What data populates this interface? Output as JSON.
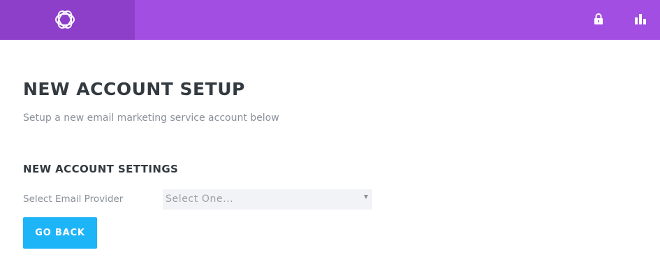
{
  "colors": {
    "topbar": "#a34ee2",
    "logo_block": "#8e3fca",
    "accent_button": "#1eb4f8",
    "heading": "#333a40",
    "muted_text": "#8a9099",
    "select_bg": "#f2f3f6"
  },
  "header": {
    "logo_icon": "bloom-logo-icon",
    "icons": [
      "lock-icon",
      "stats-icon"
    ]
  },
  "main": {
    "title": "NEW ACCOUNT SETUP",
    "subtitle": "Setup a new email marketing service account below",
    "section_title": "NEW ACCOUNT SETTINGS",
    "provider_field": {
      "label": "Select Email Provider",
      "selected": "Select One..."
    },
    "go_back_label": "GO BACK"
  }
}
